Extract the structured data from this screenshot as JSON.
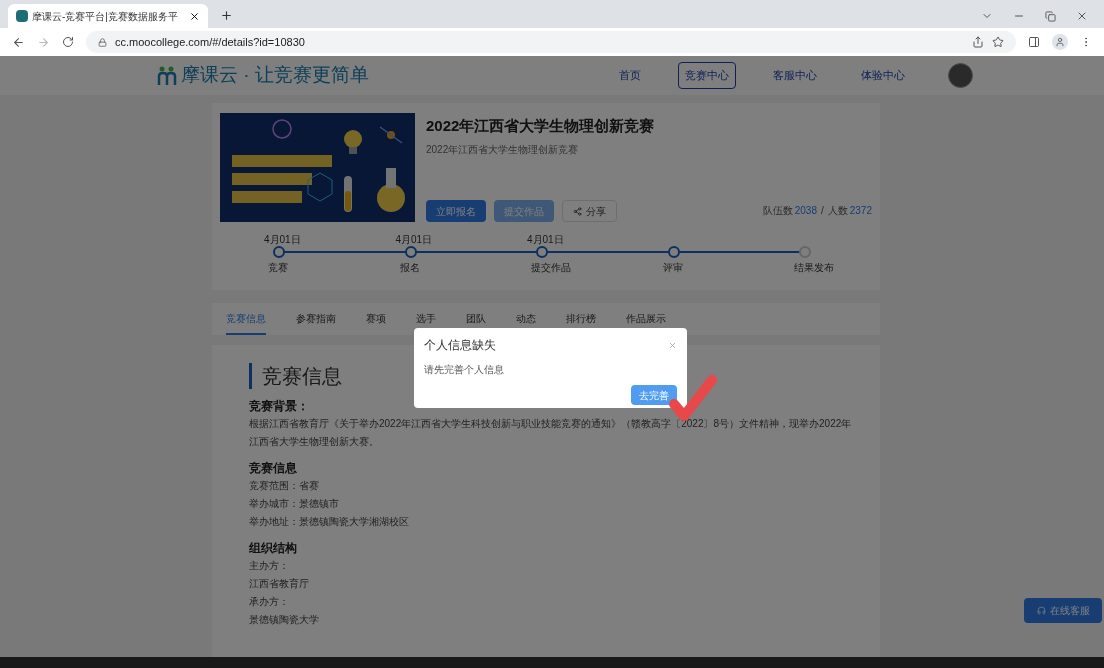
{
  "browser": {
    "tab_title": "摩课云-竞赛平台|竞赛数据服务平",
    "url": "cc.moocollege.com/#/details?id=10830"
  },
  "header": {
    "logo_text": "摩课云 · 让竞赛更简单",
    "nav": [
      {
        "label": "首页",
        "selected": false
      },
      {
        "label": "竞赛中心",
        "selected": true
      },
      {
        "label": "客服中心",
        "selected": false
      },
      {
        "label": "体验中心",
        "selected": false
      }
    ]
  },
  "competition": {
    "title": "2022年江西省大学生物理创新竞赛",
    "subtitle": "2022年江西省大学生物理创新竞赛",
    "actions": [
      {
        "kind": "primary",
        "label": "立即报名",
        "disabled": false
      },
      {
        "kind": "primary",
        "label": "提交作品",
        "disabled": true
      },
      {
        "kind": "share",
        "label": "分享",
        "disabled": false
      }
    ],
    "stats": [
      {
        "label": "队伍数",
        "value": "2038"
      },
      {
        "label": "人数",
        "value": "2372"
      }
    ],
    "stats_separator": "/",
    "timeline": [
      {
        "date": "4月01日",
        "label": "竞赛",
        "done": true
      },
      {
        "date": "4月01日",
        "label": "报名",
        "done": true
      },
      {
        "date": "4月01日",
        "label": "提交作品",
        "done": true
      },
      {
        "label": "评审",
        "done": true
      },
      {
        "label": "结果发布",
        "done": false
      }
    ]
  },
  "tabs": [
    {
      "label": "竞赛信息",
      "selected": true
    },
    {
      "label": "参赛指南",
      "selected": false
    },
    {
      "label": "赛项",
      "selected": false
    },
    {
      "label": "选手",
      "selected": false
    },
    {
      "label": "团队",
      "selected": false
    },
    {
      "label": "动态",
      "selected": false
    },
    {
      "label": "排行榜",
      "selected": false
    },
    {
      "label": "作品展示",
      "selected": false
    }
  ],
  "content": {
    "heading": "竞赛信息",
    "sections": [
      {
        "title": "竞赛背景：",
        "lines": [
          "根据江西省教育厅《关于举办2022年江西省大学生科技创新与职业技能竞赛的通知》（赣教高字〔2022〕8号）文件精神，现举办2022年江西省大学生物理创新大赛。"
        ]
      },
      {
        "title": "竞赛信息",
        "lines": [
          "竞赛范围：省赛",
          "举办城市：景德镇市",
          "举办地址：景德镇陶瓷大学湘湖校区"
        ]
      },
      {
        "title": "组织结构",
        "lines": [
          "主办方：",
          "江西省教育厅",
          "承办方：",
          "景德镇陶瓷大学"
        ]
      }
    ]
  },
  "online_service": "在线客服",
  "dialog": {
    "title": "个人信息缺失",
    "message": "请先完善个人信息",
    "confirm": "去完善"
  }
}
